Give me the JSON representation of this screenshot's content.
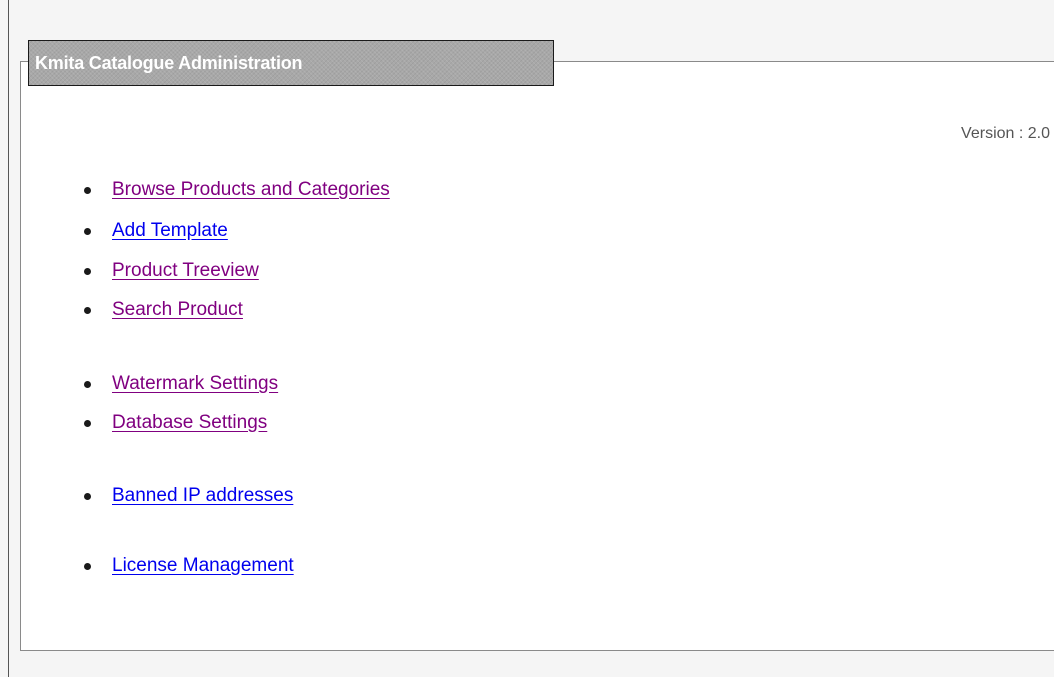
{
  "panel": {
    "title": "Kmita Catalogue Administration",
    "version_text": "Version : 2.0"
  },
  "menu": {
    "items": [
      {
        "label": "Browse Products and Categories",
        "state": "visited"
      },
      {
        "label": "Add Template",
        "state": "unvisited"
      },
      {
        "label": "Product Treeview",
        "state": "visited"
      },
      {
        "label": "Search Product",
        "state": "visited"
      },
      {
        "label": "Watermark Settings",
        "state": "visited"
      },
      {
        "label": "Database Settings",
        "state": "visited"
      },
      {
        "label": "Banned IP addresses",
        "state": "unvisited"
      },
      {
        "label": "License Management",
        "state": "unvisited"
      }
    ]
  },
  "colors": {
    "visited_link": "#800080",
    "unvisited_link": "#0000ee",
    "legend_background": "#a8a8a8"
  }
}
